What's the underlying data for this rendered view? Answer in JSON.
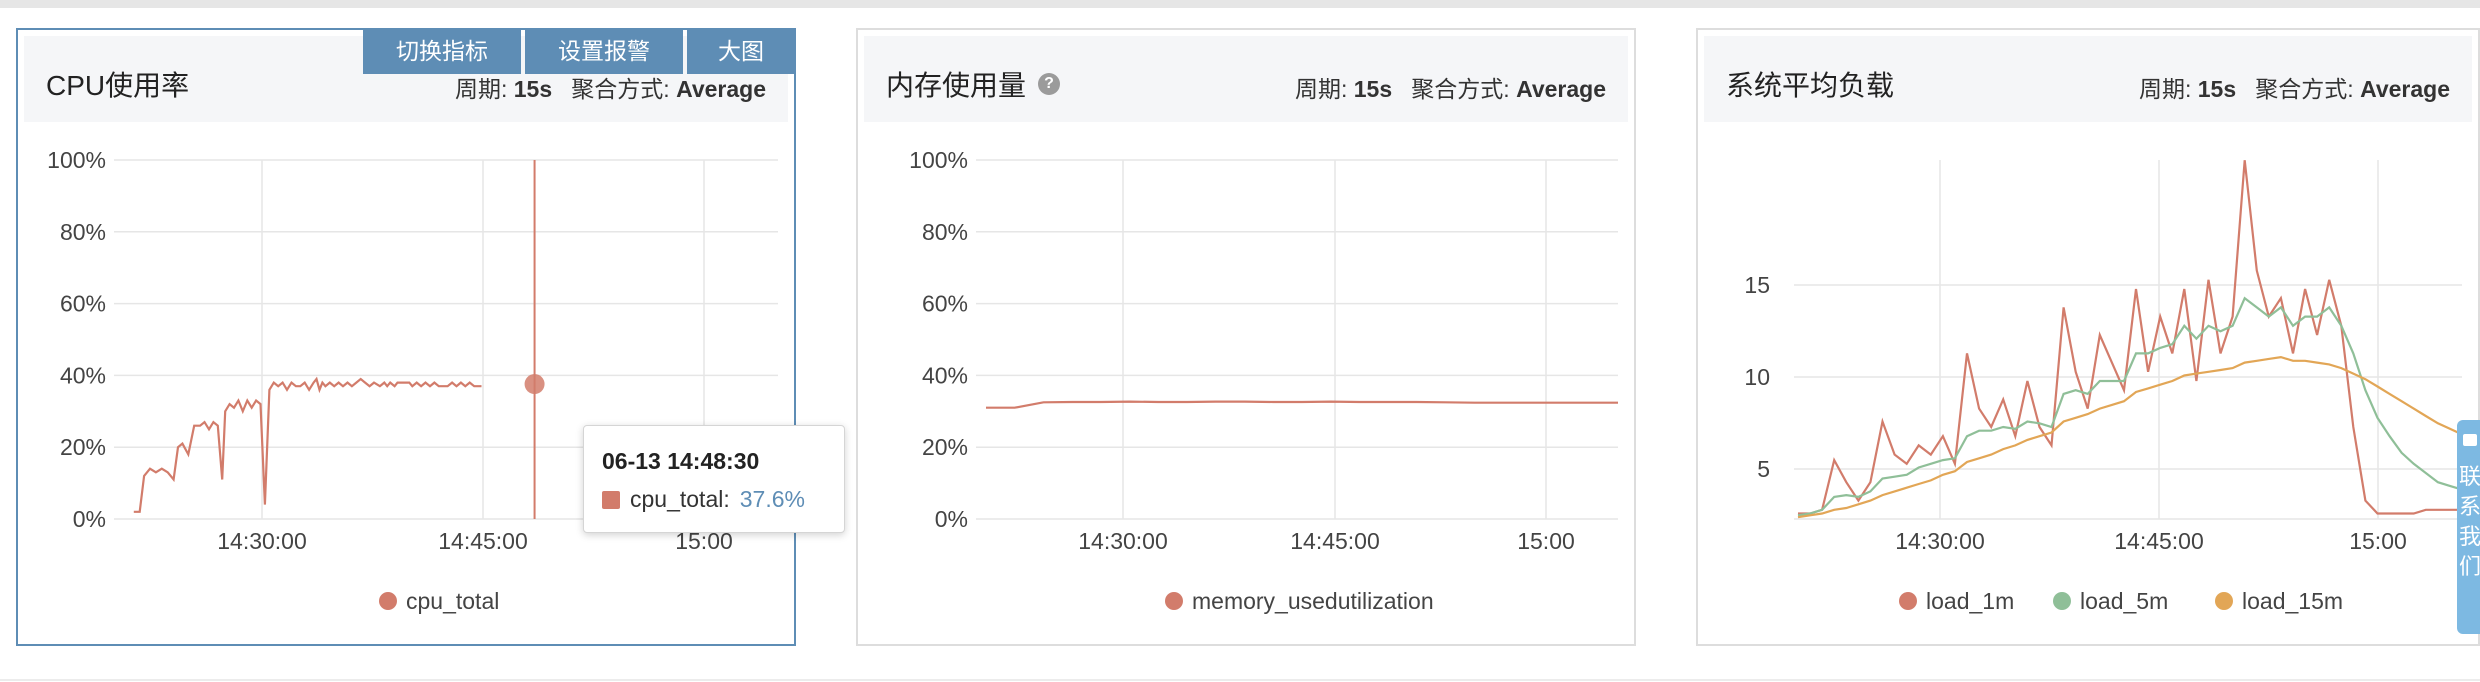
{
  "toolbar": {
    "switch_metric": "切换指标",
    "set_alarm": "设置报警",
    "enlarge": "大图"
  },
  "common": {
    "period_label": "周期: ",
    "period_value": "15s",
    "agg_label": "聚合方式: ",
    "agg_value": "Average"
  },
  "panels": [
    {
      "title": "CPU使用率"
    },
    {
      "title": "内存使用量",
      "help_icon": "?"
    },
    {
      "title": "系统平均负载"
    }
  ],
  "tooltip": {
    "time": "06-13 14:48:30",
    "series": "cpu_total:",
    "value": "37.6%"
  },
  "side_widget": {
    "text": "联系我们"
  },
  "colors": {
    "cpu_total": "#d27c6b",
    "memory": "#d27c6b",
    "load_1m": "#d27c6b",
    "load_5m": "#8fbf98",
    "load_15m": "#e2a656",
    "accent": "#5e8db5"
  },
  "chart_data": [
    {
      "type": "line",
      "title": "CPU使用率",
      "y_ticks": [
        "0%",
        "20%",
        "40%",
        "60%",
        "80%",
        "100%"
      ],
      "x_ticks": [
        "14:30:00",
        "14:45:00",
        "15:00"
      ],
      "ylim": [
        0,
        100
      ],
      "xlim_minutes": [
        -8.7,
        6.0
      ],
      "grid": true,
      "legend_position": "bottom",
      "crosshair_at": "14:48:30",
      "series": [
        {
          "name": "cpu_total",
          "color": "#d27c6b",
          "x_minutes": [
            -8.7,
            -8.3,
            -8.0,
            -7.6,
            -7.2,
            -6.8,
            -6.4,
            -6.0,
            -5.7,
            -5.4,
            -5.0,
            -4.6,
            -4.2,
            -3.9,
            -3.6,
            -3.3,
            -3.0,
            -2.7,
            -2.5,
            -2.2,
            -1.9,
            -1.6,
            -1.3,
            -1.0,
            -0.7,
            -0.4,
            -0.1,
            0.2,
            0.5,
            0.8,
            1.1,
            1.4,
            1.7,
            2.0,
            2.3,
            2.6,
            2.9,
            3.2,
            3.5,
            3.7,
            3.9,
            4.1,
            4.3,
            4.6,
            4.9,
            5.2,
            5.5,
            5.8,
            6.1,
            6.4,
            6.7,
            7.0,
            7.3,
            7.6,
            8.0,
            8.3,
            8.5,
            8.7,
            9.0,
            9.2,
            9.5,
            9.8,
            10.0,
            10.2,
            10.5,
            10.8,
            11.1,
            11.4,
            11.7,
            12.0,
            12.3,
            12.6,
            12.9,
            13.2,
            13.5,
            13.8,
            14.1,
            14.4,
            14.7,
            14.9
          ],
          "values": [
            2,
            2,
            12,
            14,
            13,
            14,
            13,
            11,
            20,
            21,
            18,
            26,
            26,
            27,
            25,
            27,
            26,
            11,
            30,
            32,
            31,
            33,
            30,
            33,
            31,
            33,
            32,
            4,
            36,
            38,
            37,
            38,
            36,
            38,
            37,
            37,
            38,
            36,
            38,
            39,
            36,
            38,
            37,
            38,
            37,
            38,
            37,
            38,
            37,
            38,
            39,
            38,
            37,
            38,
            37,
            38,
            37,
            38,
            37,
            38,
            38,
            38,
            38,
            37,
            38,
            37,
            38,
            37,
            38,
            37,
            37,
            37,
            38,
            37,
            38,
            37,
            38,
            37,
            37,
            37
          ]
        }
      ]
    },
    {
      "type": "line",
      "title": "内存使用量",
      "y_ticks": [
        "0%",
        "20%",
        "40%",
        "60%",
        "80%",
        "100%"
      ],
      "x_ticks": [
        "14:30:00",
        "14:45:00",
        "15:00"
      ],
      "ylim": [
        0,
        100
      ],
      "grid": true,
      "legend_position": "bottom",
      "series": [
        {
          "name": "memory_usedutilization",
          "color": "#d27c6b",
          "values": [
            31,
            31,
            32.5,
            32.6,
            32.6,
            32.7,
            32.6,
            32.6,
            32.7,
            32.7,
            32.6,
            32.6,
            32.7,
            32.6,
            32.6,
            32.6,
            32.5,
            32.4,
            32.4,
            32.4,
            32.4,
            32.4,
            32.4
          ]
        }
      ]
    },
    {
      "type": "line",
      "title": "系统平均负载",
      "y_ticks": [
        "5",
        "10",
        "15"
      ],
      "x_ticks": [
        "14:30:00",
        "14:45:00",
        "15:00"
      ],
      "ylim": [
        0,
        20
      ],
      "grid": true,
      "legend_position": "bottom",
      "series": [
        {
          "name": "load_1m",
          "color": "#d27c6b",
          "values": [
            0.3,
            0.3,
            0.5,
            3.2,
            2.0,
            1.0,
            2.0,
            5.3,
            3.5,
            3.0,
            4.0,
            3.5,
            4.5,
            3.0,
            9.0,
            6.0,
            5.0,
            6.5,
            4.5,
            7.5,
            5.0,
            4.0,
            11.5,
            8.0,
            6.0,
            10.0,
            8.5,
            7.0,
            12.5,
            8.0,
            11.0,
            9.0,
            12.5,
            7.5,
            13.0,
            9.0,
            11.0,
            19.5,
            13.5,
            11.0,
            12.0,
            9.0,
            12.5,
            10.0,
            13.0,
            10.5,
            5.0,
            1.0,
            0.3,
            0.3,
            0.3,
            0.3,
            0.5,
            0.5,
            0.5,
            0.5
          ]
        },
        {
          "name": "load_5m",
          "color": "#8fbf98",
          "values": [
            0.2,
            0.3,
            0.5,
            1.2,
            1.3,
            1.2,
            1.5,
            2.2,
            2.3,
            2.4,
            2.8,
            3.0,
            3.2,
            3.3,
            4.5,
            4.8,
            4.8,
            5.0,
            4.9,
            5.3,
            5.2,
            5.0,
            6.8,
            7.0,
            6.8,
            7.5,
            7.5,
            7.5,
            9.0,
            9.0,
            9.3,
            9.5,
            10.5,
            9.8,
            10.5,
            10.2,
            10.5,
            12.0,
            11.5,
            11.0,
            11.5,
            10.5,
            11.0,
            11.0,
            11.5,
            10.5,
            9.0,
            7.0,
            5.5,
            4.5,
            3.6,
            3.0,
            2.5,
            2.0,
            1.8,
            1.6
          ]
        },
        {
          "name": "load_15m",
          "color": "#e2a656",
          "values": [
            0.1,
            0.2,
            0.3,
            0.5,
            0.6,
            0.8,
            1.0,
            1.3,
            1.5,
            1.7,
            1.9,
            2.1,
            2.4,
            2.6,
            3.1,
            3.3,
            3.5,
            3.8,
            4.0,
            4.3,
            4.5,
            4.7,
            5.3,
            5.5,
            5.7,
            6.0,
            6.2,
            6.4,
            6.9,
            7.1,
            7.3,
            7.5,
            7.8,
            7.9,
            8.0,
            8.1,
            8.2,
            8.5,
            8.6,
            8.7,
            8.8,
            8.6,
            8.6,
            8.5,
            8.4,
            8.2,
            7.9,
            7.6,
            7.2,
            6.8,
            6.4,
            6.0,
            5.6,
            5.2,
            4.9,
            4.6
          ]
        }
      ]
    }
  ]
}
